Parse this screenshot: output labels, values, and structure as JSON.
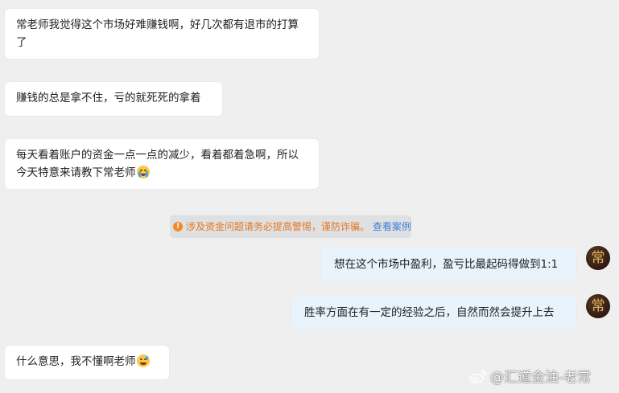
{
  "messages": [
    {
      "side": "left",
      "text": "常老师我觉得这个市场好难赚钱啊，好几次都有退市的打算了"
    },
    {
      "side": "left",
      "text": "赚钱的总是拿不住，亏的就死死的拿着"
    },
    {
      "side": "left",
      "text": "每天看着账户的资金一点一点的减少，看着都着急啊，所以今天特意来请教下常老师",
      "emoji": "crying-face"
    },
    {
      "side": "right",
      "text": "想在这个市场中盈利，盈亏比最起码得做到1:1"
    },
    {
      "side": "right",
      "text": "胜率方面在有一定的经验之后，自然而然会提升上去"
    },
    {
      "side": "left",
      "text": "什么意思，我不懂啊老师",
      "emoji": "sweat-smile-face"
    }
  ],
  "notice": {
    "icon": "info-icon",
    "warning_text": "涉及资金问题请务必提高警惕，谨防诈骗。",
    "link_text": "查看案例"
  },
  "avatar": {
    "glyph": "常"
  },
  "watermark": {
    "icon": "weibo-icon",
    "text": "@汇道金油-老常"
  },
  "colors": {
    "background": "#efefef",
    "left_bubble": "#ffffff",
    "right_bubble": "#e8f3fc",
    "warning": "#e6751b",
    "link": "#3d7fd8"
  }
}
